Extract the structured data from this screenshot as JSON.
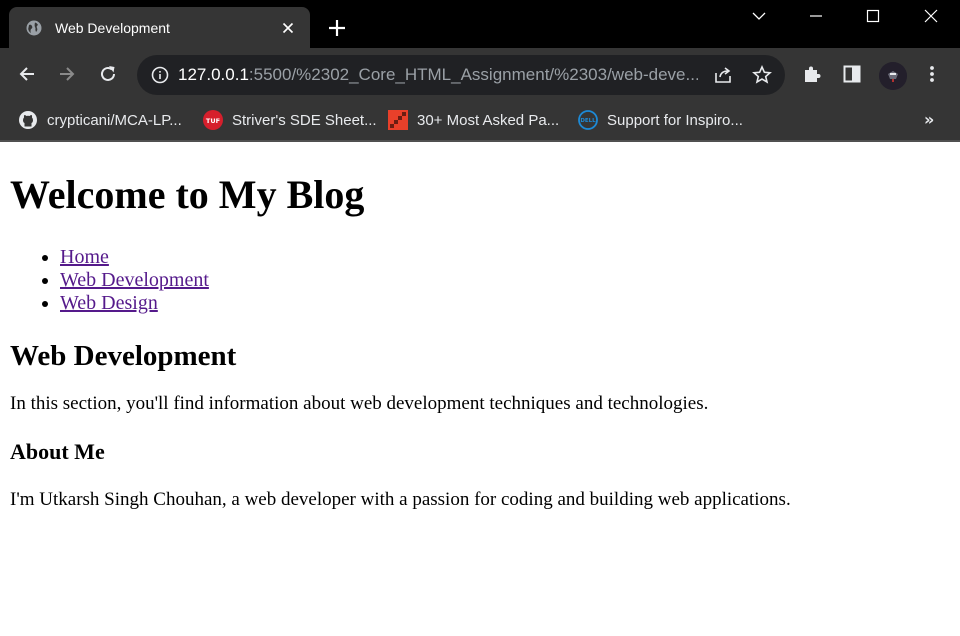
{
  "browser": {
    "tab": {
      "title": "Web Development"
    },
    "omnibox": {
      "url_host": "127.0.0.1",
      "url_rest": ":5500/%2302_Core_HTML_Assignment/%2303/web-deve..."
    },
    "bookmarks": [
      {
        "label": "crypticani/MCA-LP...",
        "icon": "github-icon"
      },
      {
        "label": "Striver's SDE Sheet...",
        "icon": "tuf-icon"
      },
      {
        "label": "30+ Most Asked Pa...",
        "icon": "stairs-icon"
      },
      {
        "label": "Support for Inspiro...",
        "icon": "dell-icon"
      }
    ],
    "bookmarks_more": "»",
    "colors": {
      "tabstrip": "#000000",
      "toolbar": "#353535",
      "omnibox": "#202124",
      "visited_link": "#551a8b"
    }
  },
  "page": {
    "heading": "Welcome to My Blog",
    "nav": [
      {
        "label": "Home"
      },
      {
        "label": "Web Development"
      },
      {
        "label": "Web Design"
      }
    ],
    "section_title": "Web Development",
    "section_text": "In this section, you'll find information about web development techniques and technologies.",
    "about_title": "About Me",
    "about_text": "I'm Utkarsh Singh Chouhan, a web developer with a passion for coding and building web applications."
  }
}
